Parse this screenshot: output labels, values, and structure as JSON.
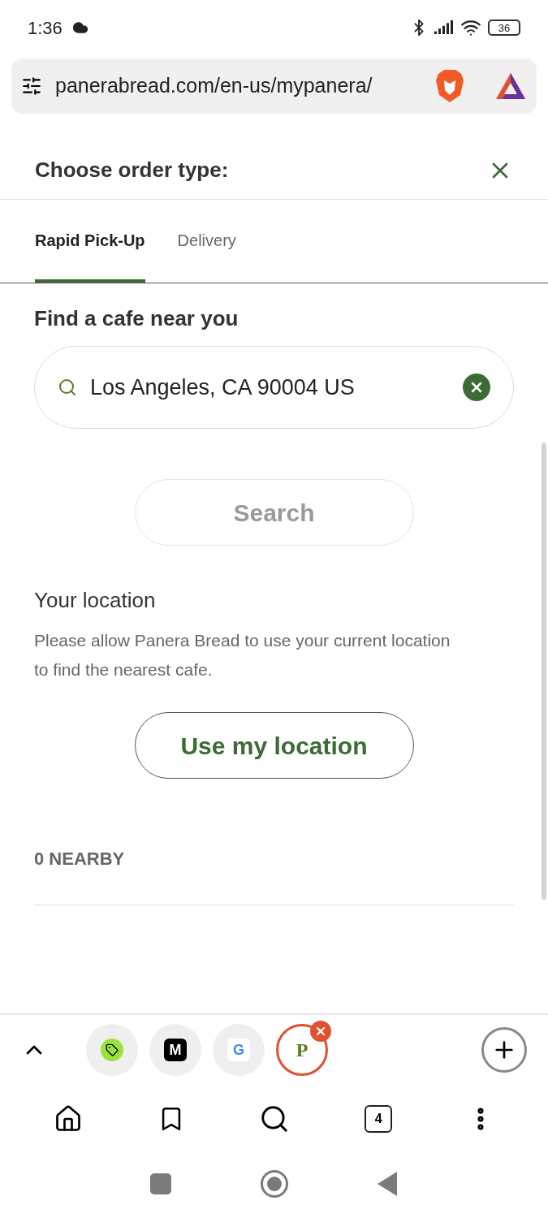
{
  "status_bar": {
    "time": "1:36",
    "battery": "36"
  },
  "address_bar": {
    "url": "panerabread.com/en-us/mypanera/"
  },
  "dialog": {
    "title": "Choose order type:",
    "tabs": [
      {
        "label": "Rapid Pick-Up",
        "selected": true
      },
      {
        "label": "Delivery",
        "selected": false
      }
    ],
    "find_heading": "Find a cafe near you",
    "search_field": {
      "value": "Los Angeles, CA 90004 US"
    },
    "search_button": {
      "label": "Search",
      "disabled": true
    },
    "location_heading": "Your location",
    "location_text": "Please allow Panera Bread to use your current location to find the nearest cafe.",
    "location_button": "Use my location",
    "nearby_count": "0 NEARBY"
  },
  "browser_tabs": [
    {
      "kind": "tag",
      "selected": false
    },
    {
      "kind": "letter",
      "glyph": "M",
      "selected": false
    },
    {
      "kind": "letter",
      "glyph": "G",
      "selected": false
    },
    {
      "kind": "letter",
      "glyph": "P",
      "selected": true
    }
  ],
  "toolbar": {
    "tab_count": "4"
  }
}
